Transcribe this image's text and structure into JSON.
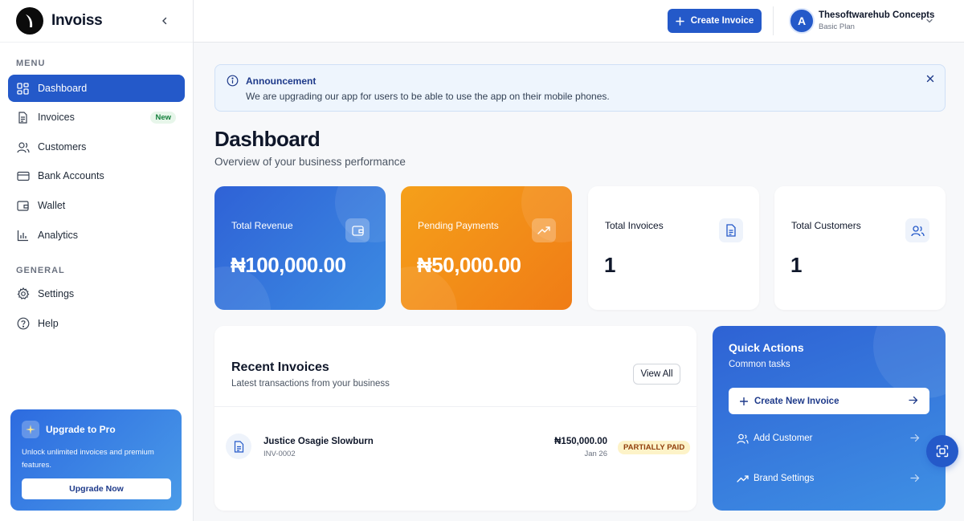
{
  "app": {
    "name": "Invoiss"
  },
  "sidebar": {
    "menu_label": "MENU",
    "general_label": "GENERAL",
    "items": [
      {
        "label": "Dashboard",
        "icon": "dashboard-icon"
      },
      {
        "label": "Invoices",
        "icon": "document-icon",
        "badge": "New"
      },
      {
        "label": "Customers",
        "icon": "users-icon"
      },
      {
        "label": "Bank Accounts",
        "icon": "credit-card-icon"
      },
      {
        "label": "Wallet",
        "icon": "wallet-icon"
      },
      {
        "label": "Analytics",
        "icon": "bar-chart-icon"
      }
    ],
    "general_items": [
      {
        "label": "Settings",
        "icon": "gear-icon"
      },
      {
        "label": "Help",
        "icon": "help-icon"
      }
    ],
    "upgrade": {
      "title": "Upgrade to Pro",
      "text": "Unlock unlimited invoices and premium features.",
      "button": "Upgrade Now"
    }
  },
  "topbar": {
    "create_label": "Create Invoice",
    "avatar_initial": "A",
    "account_name": "Thesoftwarehub Concepts",
    "account_plan": "Basic Plan"
  },
  "announcement": {
    "title": "Announcement",
    "text": "We are upgrading our app for users to be able to use the app on their mobile phones."
  },
  "page": {
    "title": "Dashboard",
    "subtitle": "Overview of your business performance"
  },
  "stats": [
    {
      "label": "Total Revenue",
      "value": "₦100,000.00",
      "icon": "wallet-icon"
    },
    {
      "label": "Pending Payments",
      "value": "₦50,000.00",
      "icon": "trend-up-icon"
    },
    {
      "label": "Total Invoices",
      "value": "1",
      "icon": "document-icon"
    },
    {
      "label": "Total Customers",
      "value": "1",
      "icon": "users-icon"
    }
  ],
  "recent": {
    "title": "Recent Invoices",
    "subtitle": "Latest transactions from your business",
    "view_all": "View All",
    "invoices": [
      {
        "customer": "Justice Osagie Slowburn",
        "number": "INV-0002",
        "amount": "₦150,000.00",
        "date": "Jan 26",
        "status": "PARTIALLY PAID"
      }
    ]
  },
  "quick_actions": {
    "title": "Quick Actions",
    "subtitle": "Common tasks",
    "primary": "Create New Invoice",
    "items": [
      {
        "label": "Add Customer",
        "icon": "user-add-icon"
      },
      {
        "label": "Brand Settings",
        "icon": "trend-up-icon"
      }
    ]
  },
  "colors": {
    "primary": "#2459c9",
    "orange": "#f28a18",
    "status_badge_bg": "#fdf3c8"
  }
}
